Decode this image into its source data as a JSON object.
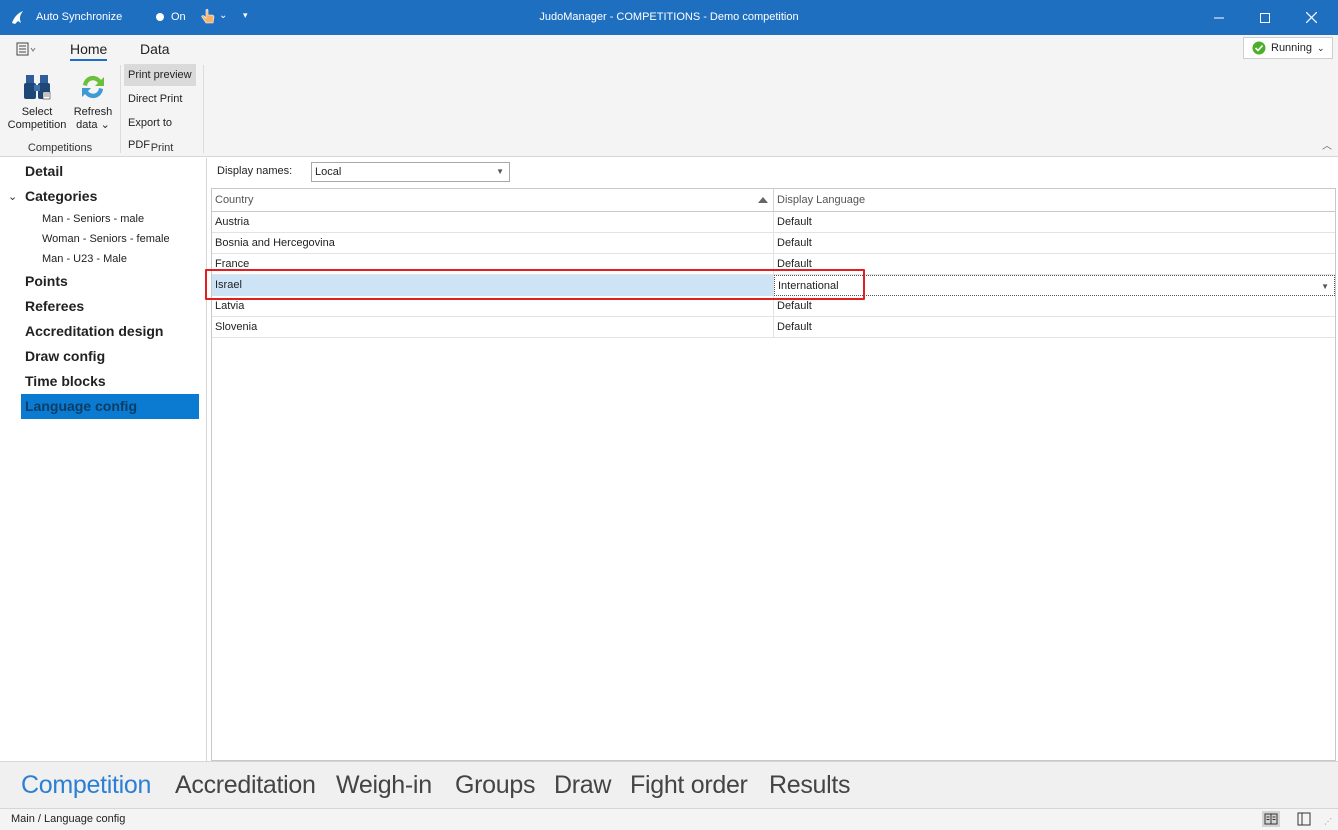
{
  "titlebar": {
    "sync_label": "Auto Synchronize",
    "sync_state": "On",
    "window_title": "JudoManager - COMPETITIONS - Demo competition"
  },
  "ribbon": {
    "tabs": [
      "Home",
      "Data"
    ],
    "status_button": "Running",
    "competitions_group": {
      "label": "Competitions",
      "select_competition": "Select Competition",
      "refresh_data": "Refresh data"
    },
    "print_group": {
      "label": "Print",
      "print_preview": "Print preview",
      "direct_print": "Direct Print",
      "export_pdf": "Export to PDF"
    }
  },
  "nav": {
    "detail": "Detail",
    "categories": "Categories",
    "subcategories": [
      "Man - Seniors - male",
      "Woman - Seniors - female",
      "Man - U23 - Male"
    ],
    "points": "Points",
    "referees": "Referees",
    "accreditation_design": "Accreditation design",
    "draw_config": "Draw config",
    "time_blocks": "Time blocks",
    "language_config": "Language config"
  },
  "content": {
    "display_names_label": "Display names:",
    "display_names_value": "Local",
    "columns": [
      "Country",
      "Display Language"
    ],
    "rows": [
      {
        "country": "Austria",
        "language": "Default"
      },
      {
        "country": "Bosnia and Hercegovina",
        "language": "Default"
      },
      {
        "country": "France",
        "language": "Default"
      },
      {
        "country": "Israel",
        "language": "International"
      },
      {
        "country": "Latvia",
        "language": "Default"
      },
      {
        "country": "Slovenia",
        "language": "Default"
      }
    ],
    "selected_row": 3
  },
  "modules": [
    "Competition",
    "Accreditation",
    "Weigh-in",
    "Groups",
    "Draw",
    "Fight order",
    "Results"
  ],
  "status": {
    "breadcrumb": "Main / Language config"
  },
  "colors": {
    "titlebar": "#1f6fc1",
    "accent": "#2b7fd4",
    "nav_selected": "#0b7ad1",
    "row_selected": "#cde4f7",
    "highlight": "#e02020"
  }
}
